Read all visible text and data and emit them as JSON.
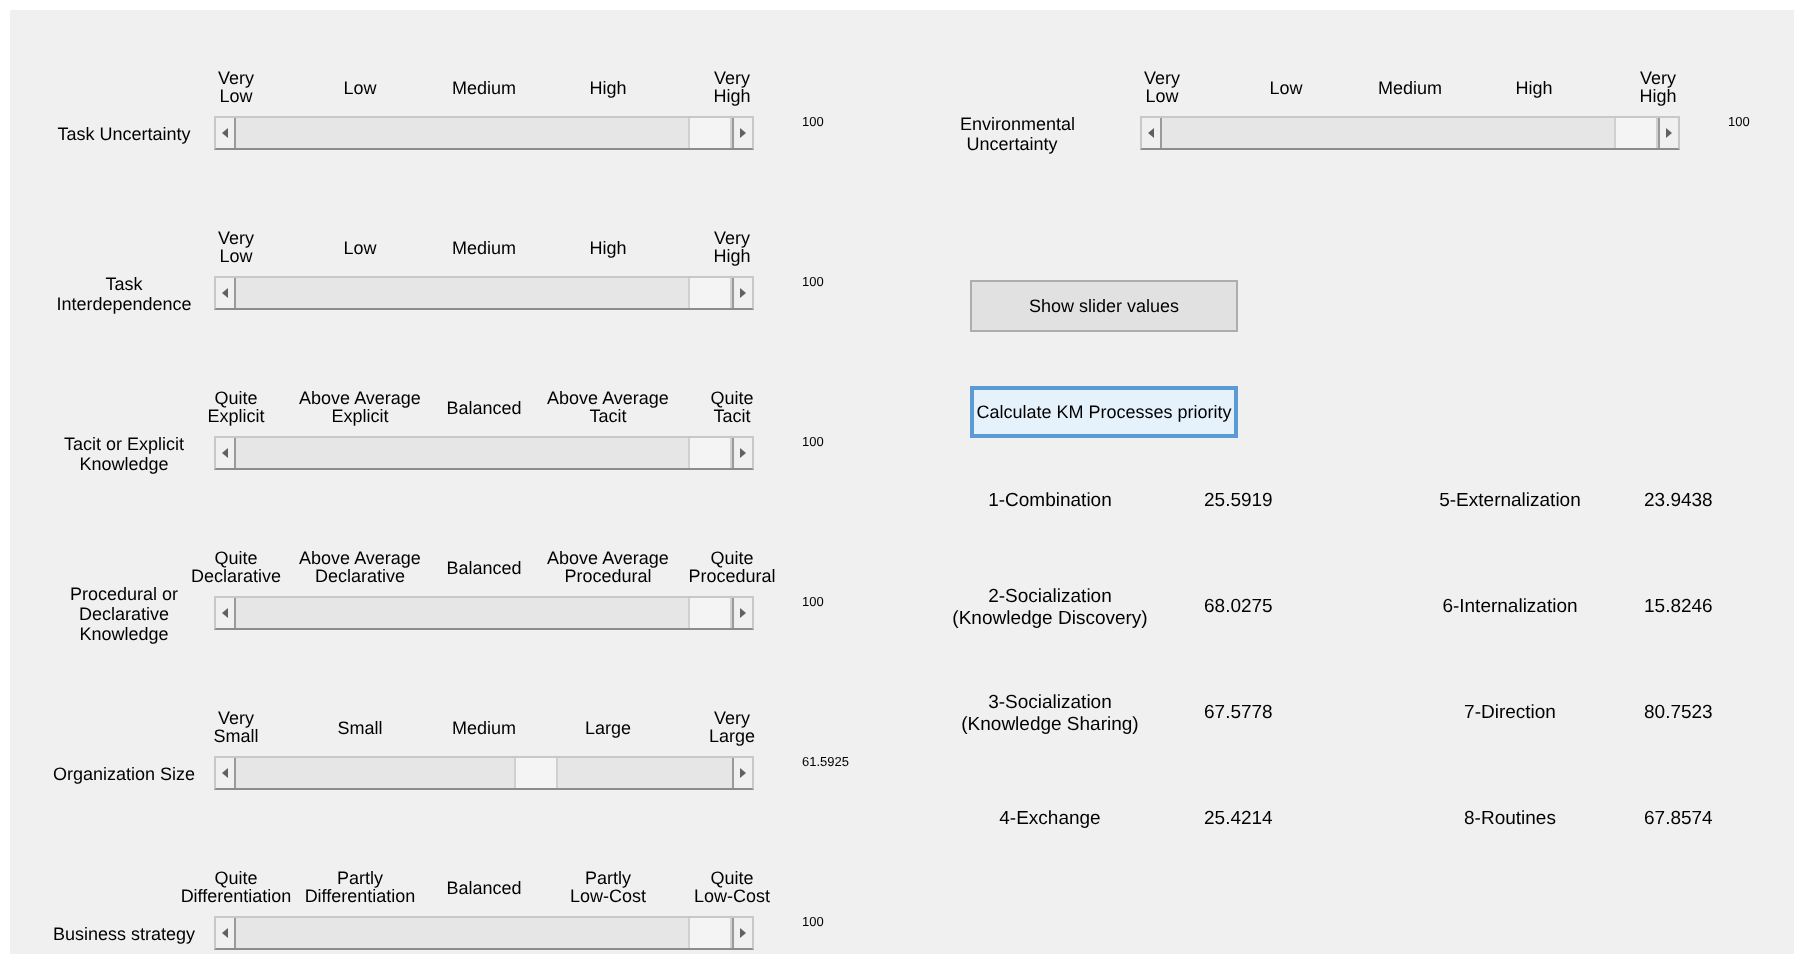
{
  "sliders": [
    {
      "label": "Task Uncertainty",
      "ticks": [
        "Very\nLow",
        "Low",
        "Medium",
        "High",
        "Very\nHigh"
      ],
      "level": 1,
      "reading": "100"
    },
    {
      "label": "Task\nInterdependence",
      "ticks": [
        "Very\nLow",
        "Low",
        "Medium",
        "High",
        "Very\nHigh"
      ],
      "level": 1,
      "reading": "100"
    },
    {
      "label": "Tacit or Explicit\nKnowledge",
      "ticks": [
        "Quite\nExplicit",
        "Above Average\nExplicit",
        "Balanced",
        "Above Average\nTacit",
        "Quite\nTacit"
      ],
      "level": 1,
      "reading": "100"
    },
    {
      "label": "Procedural or\nDeclarative\nKnowledge",
      "ticks": [
        "Quite\nDeclarative",
        "Above Average\nDeclarative",
        "Balanced",
        "Above Average\nProcedural",
        "Quite\nProcedural"
      ],
      "level": 1,
      "reading": "100"
    },
    {
      "label": "Organization Size",
      "ticks": [
        "Very\nSmall",
        "Small",
        "Medium",
        "Large",
        "Very\nLarge"
      ],
      "level": 0.6159,
      "reading": "61.5925"
    },
    {
      "label": "Business strategy",
      "ticks": [
        "Quite\nDifferentiation",
        "Partly\nDifferentiation",
        "Balanced",
        "Partly\nLow-Cost",
        "Quite\nLow-Cost"
      ],
      "level": 1,
      "reading": "100"
    }
  ],
  "environment_slider": {
    "label": "Environmental\nUncertainty",
    "ticks": [
      "Very\nLow",
      "Low",
      "Medium",
      "High",
      "Very\nHigh"
    ],
    "level": 1,
    "reading": "100"
  },
  "buttons": [
    {
      "label": "Show slider values",
      "focused": false
    },
    {
      "label": "Calculate KM Processes priority",
      "focused": true
    }
  ],
  "result_rows": [
    {
      "cells": [
        {
          "process": "1-Combination",
          "score": "25.5919"
        },
        {
          "process": "5-Externalization",
          "score": "23.9438"
        }
      ]
    },
    {
      "cells": [
        {
          "process": "2-Socialization\n(Knowledge Discovery)",
          "score": "68.0275"
        },
        {
          "process": "6-Internalization",
          "score": "15.8246"
        }
      ]
    },
    {
      "cells": [
        {
          "process": "3-Socialization\n(Knowledge Sharing)",
          "score": "67.5778"
        },
        {
          "process": "7-Direction",
          "score": "80.7523"
        }
      ]
    },
    {
      "cells": [
        {
          "process": "4-Exchange",
          "score": "25.4214"
        },
        {
          "process": "8-Routines",
          "score": "67.8574"
        }
      ]
    }
  ]
}
